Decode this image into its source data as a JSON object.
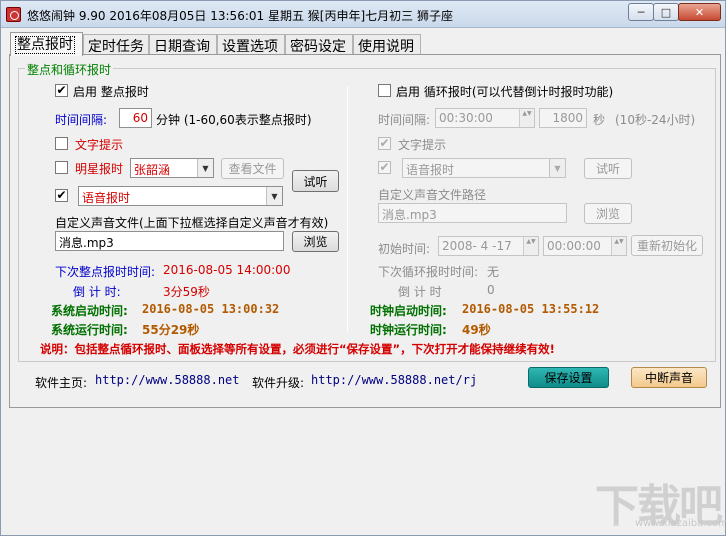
{
  "window": {
    "title": "悠悠闹钟 9.90 2016年08月05日 13:56:01 星期五 猴[丙申年]七月初三 狮子座",
    "min_label": "─",
    "max_label": "□",
    "close_label": "✕"
  },
  "tabs": [
    {
      "label": "整点报时",
      "active": true
    },
    {
      "label": "定时任务"
    },
    {
      "label": "日期查询"
    },
    {
      "label": "设置选项"
    },
    {
      "label": "密码设定"
    },
    {
      "label": "使用说明"
    }
  ],
  "group_title": "整点和循环报时",
  "left": {
    "enable_hourly": {
      "checked": true,
      "label": "启用 整点报时"
    },
    "interval_label": "时间间隔:",
    "interval_value": "60",
    "interval_unit": "分钟 (1-60,60表示整点报时)",
    "text_prompt": {
      "checked": false,
      "label": "文字提示"
    },
    "star_report": {
      "checked": false,
      "label": "明星报时",
      "selected": "张韶涵"
    },
    "view_file_label": "查看文件",
    "voice_report": {
      "checked": true,
      "selected": "语音报时"
    },
    "listen_label": "试听",
    "custom_label": "自定义声音文件(上面下拉框选择自定义声音才有效)",
    "custom_file": "消息.mp3",
    "browse_label": "浏览",
    "next_label": "下次整点报时时间:",
    "next_value": "2016-08-05 14:00:00",
    "countdown_label": "倒 计 时:",
    "countdown_value": "3分59秒"
  },
  "right": {
    "enable_cycle": {
      "checked": false,
      "label": "启用 循环报时(可以代替倒计时报时功能)"
    },
    "interval_label": "时间间隔:",
    "interval_time": "00:30:00",
    "interval_seconds": "1800",
    "seconds_unit": "秒",
    "range_hint": "(10秒-24小时)",
    "text_prompt": {
      "checked": true,
      "label": "文字提示"
    },
    "voice_report": {
      "checked": true,
      "selected": "语音报时"
    },
    "listen_label": "试听",
    "custom_path_label": "自定义声音文件路径",
    "custom_file": "消息.mp3",
    "browse_label": "浏览",
    "init_time_label": "初始时间:",
    "init_date": "2008- 4 -17",
    "init_time": "00:00:00",
    "reinit_label": "重新初始化",
    "next_label": "下次循环报时时间:",
    "next_value": "无",
    "countdown_label": "倒 计 时",
    "countdown_value": "0"
  },
  "stats": {
    "sys_start_label": "系统启动时间:",
    "sys_start_value": "2016-08-05 13:00:32",
    "sys_run_label": "系统运行时间:",
    "sys_run_value": "55分29秒",
    "clock_start_label": "时钟启动时间:",
    "clock_start_value": "2016-08-05 13:55:12",
    "clock_run_label": "时钟运行时间:",
    "clock_run_value": "49秒"
  },
  "notice": "说明：包括整点循环报时、面板选择等所有设置，必须进行“保存设置”，下次打开才能保持继续有效!",
  "footer": {
    "home_label": "软件主页:",
    "home_url": "http://www.58888.net",
    "upgrade_label": "软件升级:",
    "upgrade_url": "http://www.58888.net/rj",
    "save_label": "保存设置",
    "stop_label": "中断声音"
  },
  "watermark": {
    "main": "下载吧",
    "sub": "www.xiazaiba.com"
  },
  "check_glyph": "✔",
  "combo_arrow": "▼",
  "spin_glyph": "▲▼"
}
